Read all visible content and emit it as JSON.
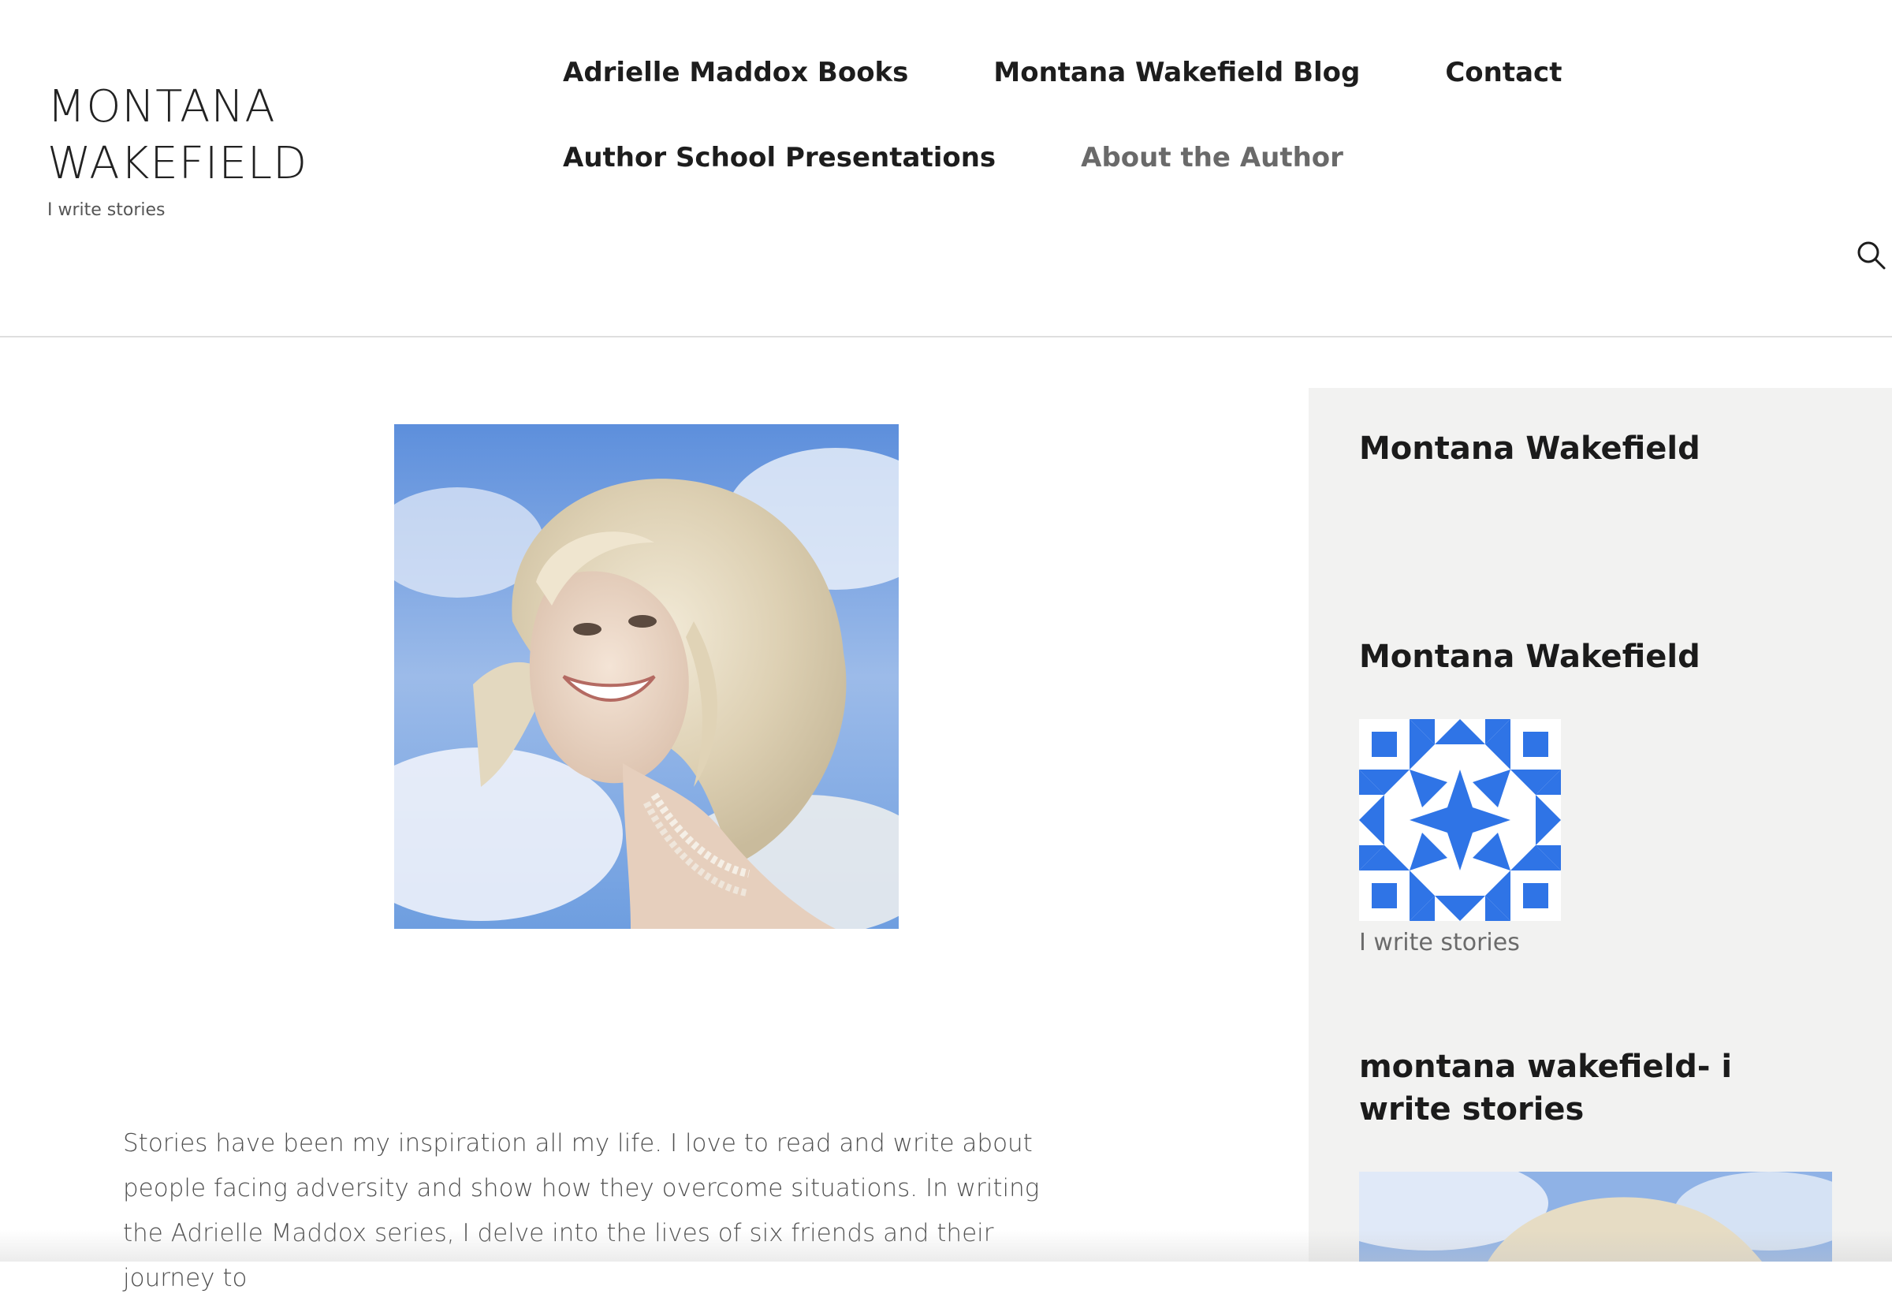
{
  "site": {
    "title": "MONTANA WAKEFIELD",
    "tagline": "I write stories"
  },
  "nav": {
    "row1": [
      {
        "label": "Adrielle Maddox Books"
      },
      {
        "label": "Montana Wakefield Blog"
      },
      {
        "label": "Contact"
      }
    ],
    "row2": [
      {
        "label": "Author School Presentations"
      },
      {
        "label": "About the Author",
        "current": true
      }
    ],
    "search_icon": "search-icon"
  },
  "content": {
    "photo_alt": "author-portrait",
    "paragraph": "Stories have been my inspiration all my life. I love to read and write about people facing adversity and show how they overcome situations. In writing the Adrielle Maddox series, I delve into the lives of six friends and their journey to"
  },
  "sidebar": {
    "widget1_title": "Montana Wakefield",
    "widget2_title": "Montana Wakefield",
    "widget2_caption": "I write stories",
    "widget3_title": "montana wakefield- i write stories"
  },
  "colors": {
    "nav_current": "#6a6a6a",
    "sidebar_bg": "#f2f2f1",
    "gravatar_blue": "#2f74e6",
    "sky_blue": "#5b8fd8"
  }
}
